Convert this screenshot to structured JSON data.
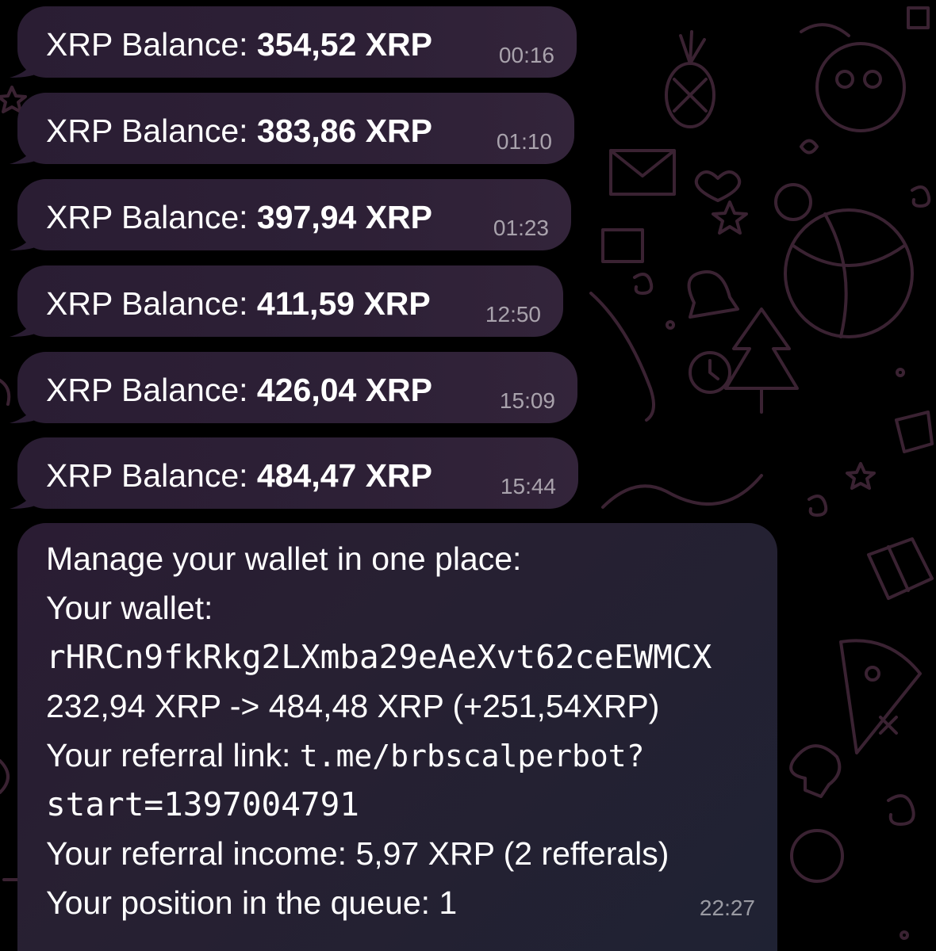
{
  "chat": {
    "messages": [
      {
        "label": "XRP Balance: ",
        "amount": "354,52 XRP",
        "time": "00:16"
      },
      {
        "label": "XRP Balance: ",
        "amount": "383,86 XRP",
        "time": "01:10"
      },
      {
        "label": "XRP Balance: ",
        "amount": "397,94 XRP",
        "time": "01:23"
      },
      {
        "label": "XRP Balance: ",
        "amount": "411,59 XRP",
        "time": "12:50"
      },
      {
        "label": "XRP Balance: ",
        "amount": "426,04 XRP",
        "time": "15:09"
      },
      {
        "label": "XRP Balance: ",
        "amount": "484,47 XRP",
        "time": "15:44"
      }
    ],
    "wallet_message": {
      "heading": "Manage your wallet in one place:",
      "wallet_label": "Your wallet:",
      "wallet_address": "rHRCn9fkRkg2LXmba29eAeXvt62ceEWMCX",
      "balance_change": "232,94 XRP -> 484,48 XRP (+251,54XRP)",
      "referral_label": "Your referral link: ",
      "referral_link_part1": "t.me/brbscalperbot?",
      "referral_link_part2": "start=1397004791",
      "referral_income": "Your referral income: 5,97 XRP (2 refferals)",
      "queue_position": "Your position in the queue: 1",
      "time": "22:27"
    }
  },
  "colors": {
    "background": "#000000",
    "bubble": "#2c1f35",
    "text": "#ffffff",
    "timestamp": "#9a93a0",
    "doodle_stroke": "#3b2433"
  }
}
